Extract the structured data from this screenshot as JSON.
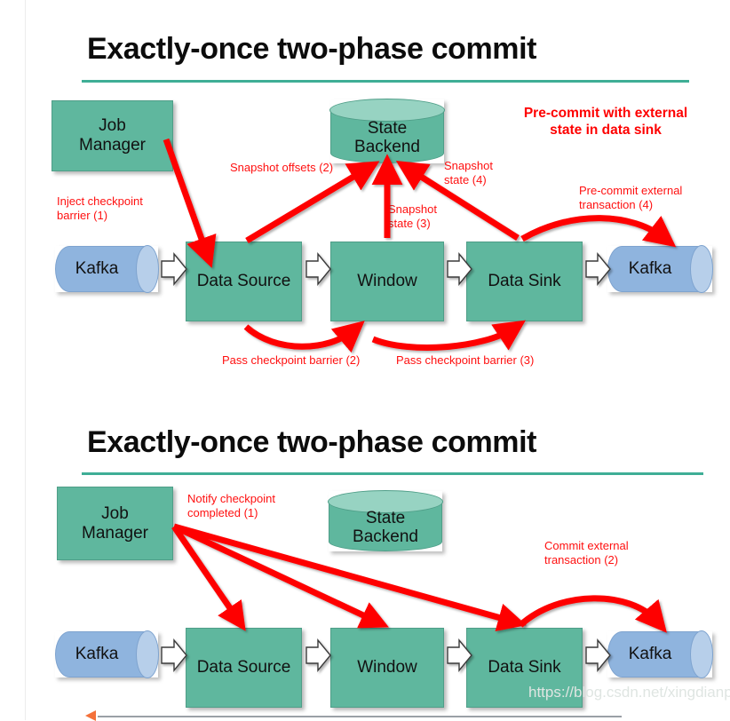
{
  "slides": [
    {
      "title": "Exactly-once two-phase commit",
      "callout": "Pre-commit with external\nstate in data sink",
      "nodes": {
        "job_manager": "Job\nManager",
        "state_backend_line1": "State",
        "state_backend_line2": "Backend",
        "kafka_in": "Kafka",
        "data_source": "Data Source",
        "window": "Window",
        "data_sink": "Data Sink",
        "kafka_out": "Kafka"
      },
      "annotations": [
        "Inject checkpoint\nbarrier (1)",
        "Snapshot offsets (2)",
        "Snapshot\nstate (4)",
        "Snapshot\nstate (3)",
        "Pre-commit external\ntransaction (4)",
        "Pass checkpoint barrier (2)",
        "Pass checkpoint barrier (3)"
      ]
    },
    {
      "title": "Exactly-once two-phase commit",
      "nodes": {
        "job_manager": "Job\nManager",
        "state_backend_line1": "State",
        "state_backend_line2": "Backend",
        "kafka_in": "Kafka",
        "data_source": "Data Source",
        "window": "Window",
        "data_sink": "Data Sink",
        "kafka_out": "Kafka"
      },
      "annotations": [
        "Notify checkpoint\ncompleted (1)",
        "Commit external\ntransaction (2)"
      ]
    }
  ],
  "watermark": "https://blog.csdn.net/xingdianp",
  "colors": {
    "process_green": "#5fb79e",
    "kafka_blue": "#8fb4de",
    "annotation_red": "#ff1010",
    "title_rule_teal": "#3fae96",
    "title_black": "#0c0c0c"
  }
}
